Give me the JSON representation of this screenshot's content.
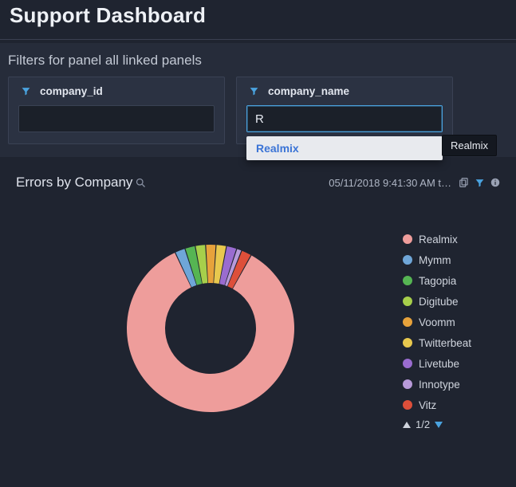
{
  "header": {
    "title": "Support Dashboard"
  },
  "filters": {
    "section_title": "Filters for panel all linked panels",
    "items": [
      {
        "name": "company_id",
        "value": "",
        "placeholder": ""
      },
      {
        "name": "company_name",
        "value": "R",
        "placeholder": ""
      }
    ],
    "autocomplete": {
      "option": "Realmix"
    },
    "tooltip": "Realmix"
  },
  "panel": {
    "title": "Errors by Company",
    "timestamp": "05/11/2018 9:41:30 AM t…",
    "legend_page": "1/2"
  },
  "chart_data": {
    "type": "pie",
    "title": "Errors by Company",
    "series": [
      {
        "name": "Realmix",
        "value": 85,
        "color": "#ee9d9b"
      },
      {
        "name": "Mymm",
        "value": 2,
        "color": "#6fa6d8"
      },
      {
        "name": "Tagopia",
        "value": 2,
        "color": "#56b553"
      },
      {
        "name": "Digitube",
        "value": 2,
        "color": "#a7cf4b"
      },
      {
        "name": "Voomm",
        "value": 2,
        "color": "#e7a23b"
      },
      {
        "name": "Twitterbeat",
        "value": 2,
        "color": "#e8c84e"
      },
      {
        "name": "Livetube",
        "value": 2,
        "color": "#9a6cd0"
      },
      {
        "name": "Innotype",
        "value": 1,
        "color": "#b89ad9"
      },
      {
        "name": "Vitz",
        "value": 2,
        "color": "#dd4f3a"
      }
    ]
  }
}
